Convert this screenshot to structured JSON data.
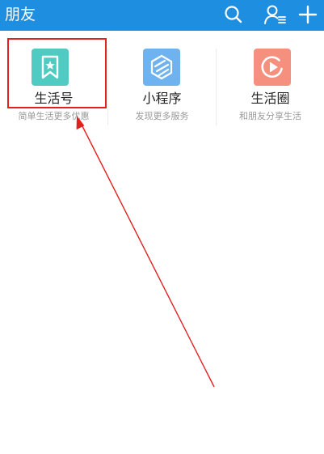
{
  "header": {
    "title": "朋友",
    "background_color": "#1e8ee0",
    "icons": [
      "search-icon",
      "contacts-icon",
      "add-icon"
    ]
  },
  "tiles": [
    {
      "label": "生活号",
      "subtitle": "简单生活更多优惠",
      "icon": "bookmark-star-icon",
      "icon_color": "#4fcbc2"
    },
    {
      "label": "小程序",
      "subtitle": "发现更多服务",
      "icon": "mini-program-icon",
      "icon_color": "#6fb2f0"
    },
    {
      "label": "生活圈",
      "subtitle": "和朋友分享生活",
      "icon": "play-circle-icon",
      "icon_color": "#f5907e"
    }
  ],
  "annotation": {
    "color": "#e0221f",
    "highlighted": "生活号"
  }
}
